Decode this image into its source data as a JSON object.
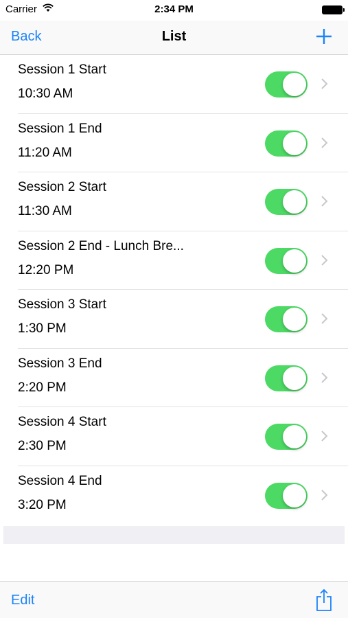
{
  "status_bar": {
    "carrier": "Carrier",
    "time": "2:34 PM"
  },
  "nav": {
    "back_label": "Back",
    "title": "List",
    "add_icon": "plus-icon"
  },
  "rows": [
    {
      "label": "Session 1 Start",
      "time": "10:30 AM",
      "enabled": true
    },
    {
      "label": "Session 1 End",
      "time": "11:20 AM",
      "enabled": true
    },
    {
      "label": "Session 2 Start",
      "time": "11:30 AM",
      "enabled": true
    },
    {
      "label": "Session 2 End - Lunch Bre...",
      "time": "12:20 PM",
      "enabled": true
    },
    {
      "label": "Session 3 Start",
      "time": "1:30 PM",
      "enabled": true
    },
    {
      "label": "Session 3 End",
      "time": "2:20 PM",
      "enabled": true
    },
    {
      "label": "Session 4 Start",
      "time": "2:30 PM",
      "enabled": true
    },
    {
      "label": "Session 4 End",
      "time": "3:20 PM",
      "enabled": true
    }
  ],
  "toolbar": {
    "edit_label": "Edit",
    "share_icon": "share-icon"
  },
  "colors": {
    "accent": "#1a82fb",
    "toggle_on": "#4cd964"
  }
}
